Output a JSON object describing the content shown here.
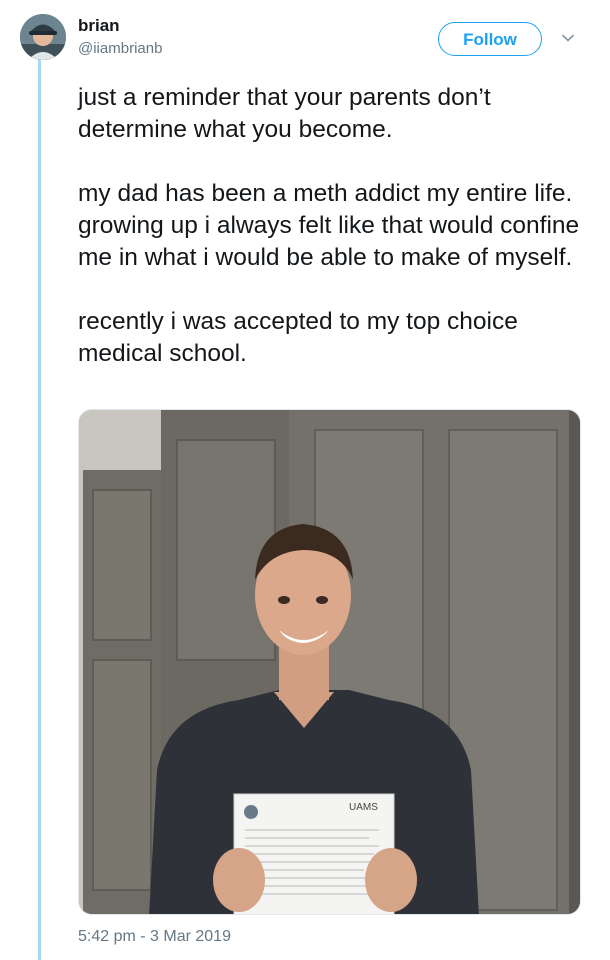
{
  "user": {
    "display_name": "brian",
    "handle": "@iiambrianb",
    "avatar_icon": "profile-photo"
  },
  "actions": {
    "follow_label": "Follow",
    "menu_icon": "chevron-down-icon"
  },
  "tweet": {
    "paragraphs": [
      "just a reminder that your parents don’t determine what you become.",
      "my dad has been a meth addict my entire life. growing up i always felt like that would confine me in what i would be able to make of myself.",
      "recently i was accepted to my top choice medical school."
    ],
    "media": {
      "description_icon": "photo-man-holding-acceptance-letter",
      "letter_logo_text": "UAMS"
    },
    "timestamp": "5:42 pm - 3 Mar 2019"
  },
  "colors": {
    "accent": "#1da1f2",
    "thread_line": "#a9d8f5",
    "secondary_text": "#657786",
    "primary_text": "#14171a"
  }
}
